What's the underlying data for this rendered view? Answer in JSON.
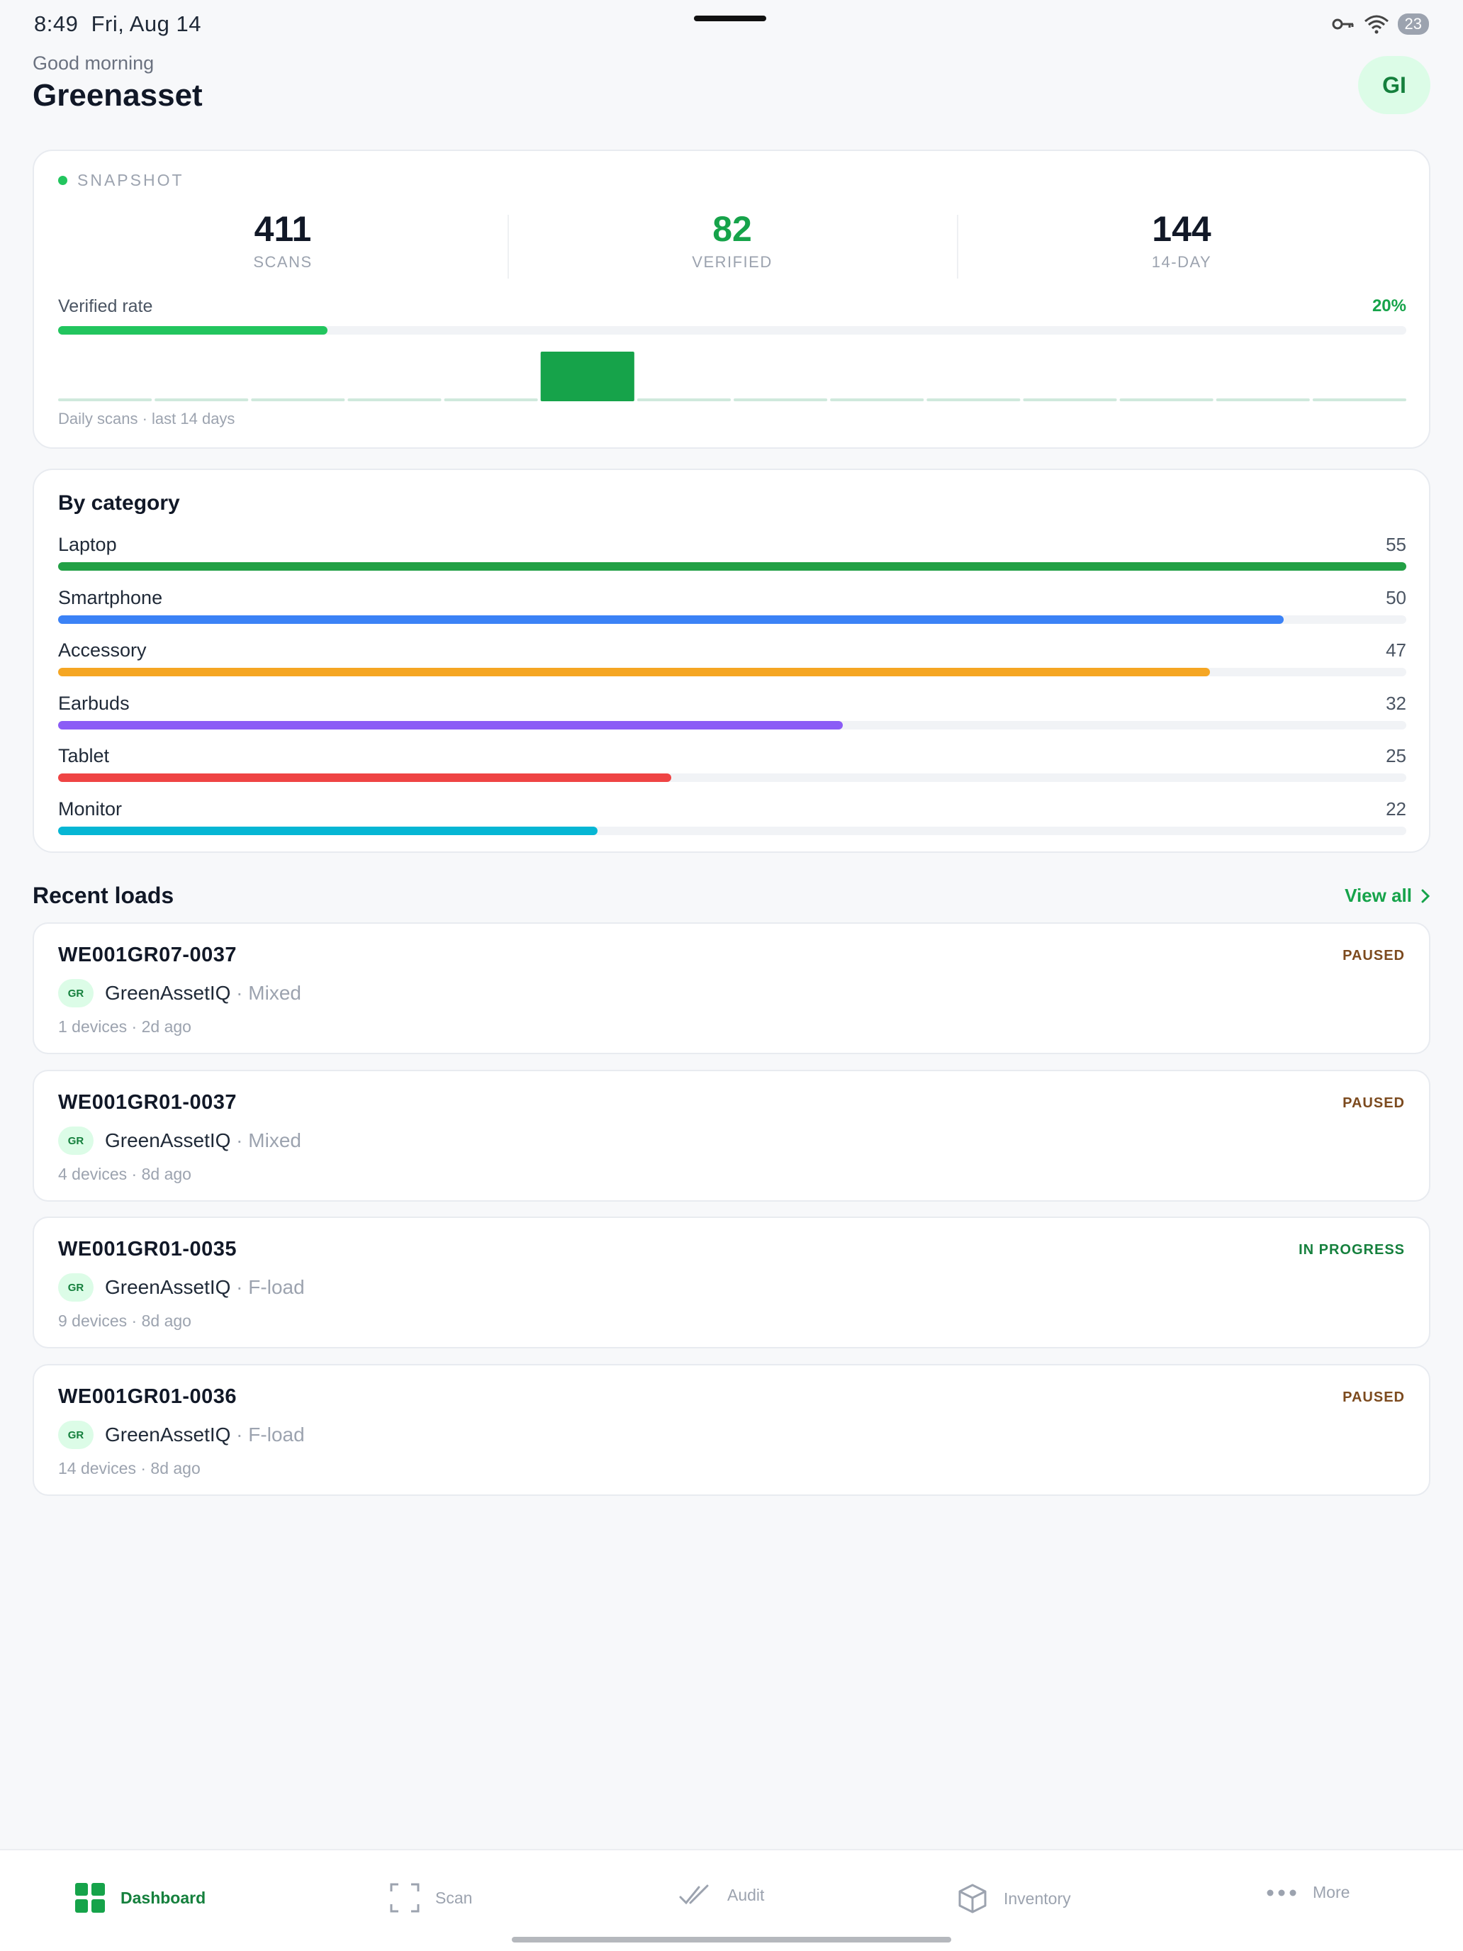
{
  "status_bar": {
    "time": "8:49",
    "date": "Fri, Aug 14",
    "battery": "23"
  },
  "header": {
    "greeting": "Good morning",
    "org_name": "Greenasset",
    "avatar_initials": "GI"
  },
  "snapshot": {
    "label": "SNAPSHOT",
    "metrics": [
      {
        "value": "411",
        "label": "SCANS"
      },
      {
        "value": "82",
        "label": "VERIFIED"
      },
      {
        "value": "144",
        "label": "14-DAY"
      }
    ],
    "verified_rate_label": "Verified rate",
    "verified_rate_text": "20%",
    "verified_rate": 0.2,
    "sparkline_caption": "Daily scans · last 14 days",
    "sparkline_days": [
      0,
      0,
      0,
      0,
      0,
      1,
      0,
      0,
      0,
      0,
      0,
      0,
      0,
      0
    ]
  },
  "category": {
    "title": "By category",
    "items": [
      {
        "name": "Laptop",
        "value": "55",
        "color": "#22a045"
      },
      {
        "name": "Smartphone",
        "value": "50",
        "color": "#3b82f6"
      },
      {
        "name": "Accessory",
        "value": "47",
        "color": "#f5a623"
      },
      {
        "name": "Earbuds",
        "value": "32",
        "color": "#8b5cf6"
      },
      {
        "name": "Tablet",
        "value": "25",
        "color": "#ef4444"
      },
      {
        "name": "Monitor",
        "value": "22",
        "color": "#06b6d4"
      }
    ]
  },
  "recent": {
    "title": "Recent loads",
    "view_all": "View all",
    "loads": [
      {
        "id": "WE001GR07-0037",
        "status": "PAUSED",
        "badge": "GR",
        "company": "GreenAssetIQ",
        "type": "Mixed",
        "sub": "1 devices · 2d ago"
      },
      {
        "id": "WE001GR01-0037",
        "status": "PAUSED",
        "badge": "GR",
        "company": "GreenAssetIQ",
        "type": "Mixed",
        "sub": "4 devices · 8d ago"
      },
      {
        "id": "WE001GR01-0035",
        "status": "IN PROGRESS",
        "badge": "GR",
        "company": "GreenAssetIQ",
        "type": "F-load",
        "sub": "9 devices · 8d ago"
      },
      {
        "id": "WE001GR01-0036",
        "status": "PAUSED",
        "badge": "GR",
        "company": "GreenAssetIQ",
        "type": "F-load",
        "sub": "14 devices · 8d ago"
      }
    ]
  },
  "nav": {
    "items": [
      {
        "label": "Dashboard",
        "icon": "grid-icon",
        "active": true
      },
      {
        "label": "Scan",
        "icon": "scan-frame-icon",
        "active": false
      },
      {
        "label": "Audit",
        "icon": "double-check-icon",
        "active": false
      },
      {
        "label": "Inventory",
        "icon": "box-icon",
        "active": false
      },
      {
        "label": "More",
        "icon": "more-dots-icon",
        "active": false
      }
    ]
  }
}
